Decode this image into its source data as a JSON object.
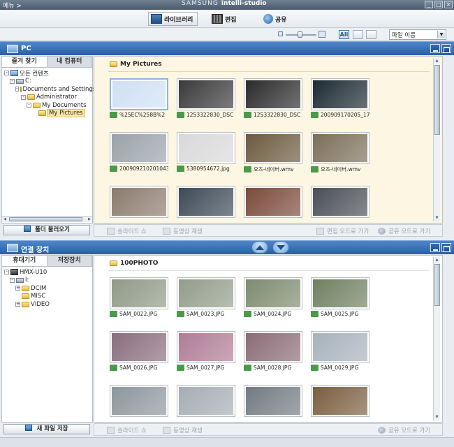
{
  "titlebar": {
    "menu": "메뉴 >",
    "brand_samsung": "SAMSUNG",
    "brand_product": "Intelli-studio",
    "min": "_",
    "max": "□",
    "close": "×"
  },
  "modes": [
    {
      "label": "라이브러리",
      "icon": "library-icon"
    },
    {
      "label": "편집",
      "icon": "film-icon"
    },
    {
      "label": "공유",
      "icon": "globe-icon"
    }
  ],
  "toolbar": {
    "view_all": "All",
    "sort_value": "파일 이름"
  },
  "pc_panel": {
    "title": "PC",
    "tabs": [
      "즐겨 찾기",
      "내 컴퓨터"
    ],
    "tree": [
      {
        "label": "모든 컨텐츠",
        "depth": 0,
        "type": "pc",
        "expander": "-"
      },
      {
        "label": "C:",
        "depth": 1,
        "type": "drive",
        "expander": "-"
      },
      {
        "label": "Documents and Settings",
        "depth": 2,
        "type": "folder",
        "expander": "-"
      },
      {
        "label": "Administrator",
        "depth": 3,
        "type": "folder",
        "expander": "-"
      },
      {
        "label": "My Documents",
        "depth": 4,
        "type": "folder",
        "expander": "-"
      },
      {
        "label": "My Pictures",
        "depth": 5,
        "type": "folder",
        "expander": "",
        "selected": true
      }
    ],
    "folder_button": "폴더 불러오기",
    "folder_title": "My Pictures",
    "items": [
      {
        "name": "%25EC%258B%2",
        "color": "#cfe0f3",
        "selected": true
      },
      {
        "name": "1253322830_DSC",
        "color": "#3a3a3a"
      },
      {
        "name": "1253322830_DSC",
        "color": "#2b2b2b"
      },
      {
        "name": "200909170205_17",
        "color": "#1d2a33"
      },
      {
        "name": "200909210201043",
        "color": "#9aa3aa"
      },
      {
        "name": "5380954672.jpg",
        "color": "#d9d9d9"
      },
      {
        "name": "오즈-네이버.wmv",
        "color": "#6b5a3e"
      },
      {
        "name": "오즈-네이버.wmv",
        "color": "#7c6f58"
      },
      {
        "name": "",
        "color": "#8c7b6e"
      },
      {
        "name": "",
        "color": "#3d4a57"
      },
      {
        "name": "",
        "color": "#7a4a3a"
      },
      {
        "name": "",
        "color": "#4a4f55"
      }
    ],
    "actions": {
      "slideshow": "슬라이드 쇼",
      "play": "동영상 재생",
      "edit_mode": "편집 모드로 가기",
      "share_mode": "공유 모드로 가기"
    }
  },
  "device_panel": {
    "title": "연결 장치",
    "tabs": [
      "휴대기기",
      "저장장치"
    ],
    "tree": [
      {
        "label": "HMX-U10",
        "depth": 0,
        "type": "cam",
        "expander": "-"
      },
      {
        "label": "I:",
        "depth": 1,
        "type": "drive",
        "expander": "-"
      },
      {
        "label": "DCIM",
        "depth": 2,
        "type": "folder",
        "expander": "+"
      },
      {
        "label": "MISC",
        "depth": 2,
        "type": "folder",
        "expander": ""
      },
      {
        "label": "VIDEO",
        "depth": 2,
        "type": "folder",
        "expander": "+"
      }
    ],
    "save_button": "새 파일 저장",
    "folder_title": "100PHOTO",
    "items": [
      {
        "name": "SAM_0022.JPG",
        "color": "#8f9a86"
      },
      {
        "name": "SAM_0023.JPG",
        "color": "#939d8b"
      },
      {
        "name": "SAM_0024.JPG",
        "color": "#7d8b6e"
      },
      {
        "name": "SAM_0025.JPG",
        "color": "#6f8060"
      },
      {
        "name": "SAM_0026.JPG",
        "color": "#8a6d7e"
      },
      {
        "name": "SAM_0027.JPG",
        "color": "#b07c95"
      },
      {
        "name": "SAM_0028.JPG",
        "color": "#8b6b76"
      },
      {
        "name": "SAM_0029.JPG",
        "color": "#a7b2bc"
      },
      {
        "name": "",
        "color": "#8d969e"
      },
      {
        "name": "",
        "color": "#a5adb4"
      },
      {
        "name": "",
        "color": "#727b82"
      },
      {
        "name": "",
        "color": "#7a5e3f"
      }
    ],
    "actions": {
      "slideshow": "슬라이드 쇼",
      "play": "동영상 재생",
      "share_mode": "공유 모드로 가기"
    }
  }
}
